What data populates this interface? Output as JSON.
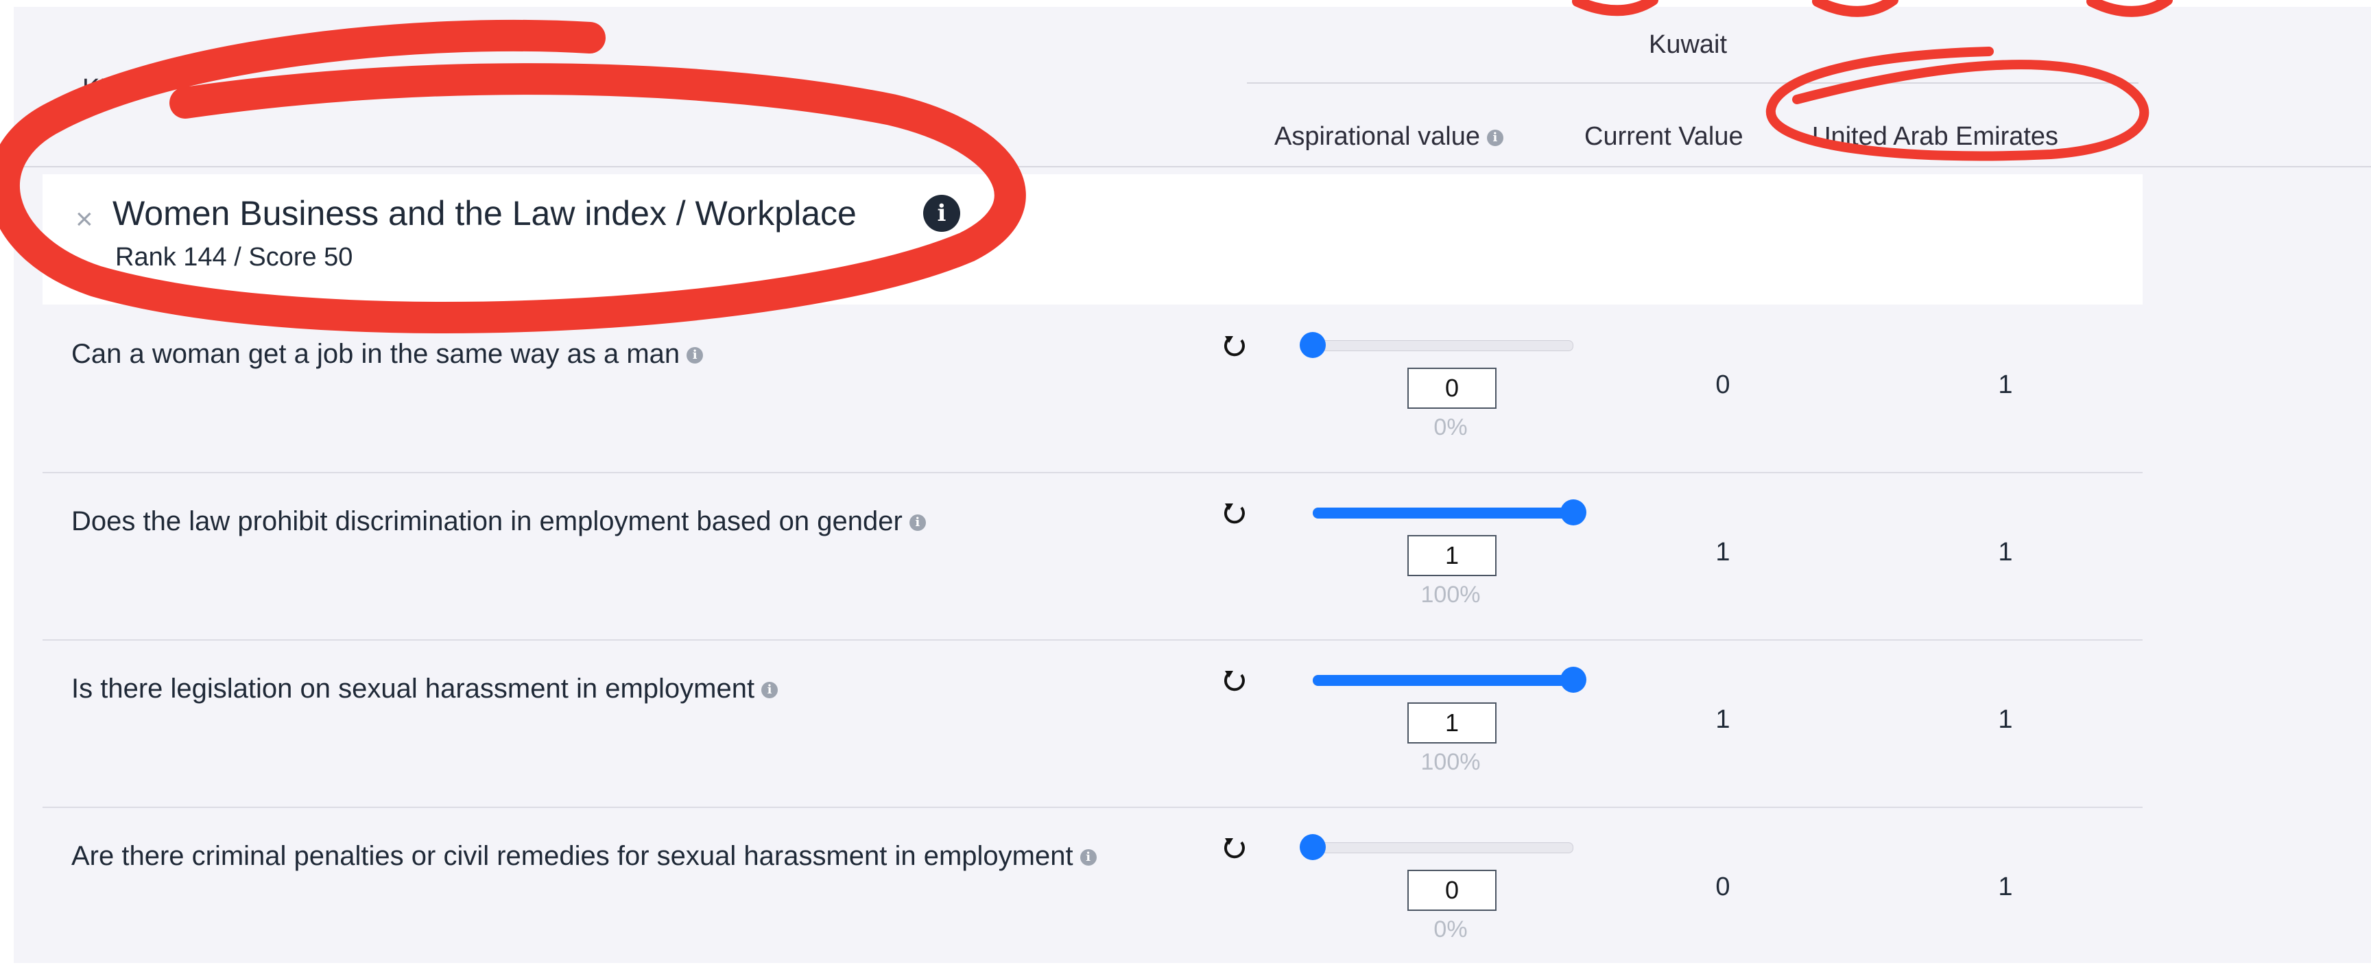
{
  "header": {
    "kpi_label": "KPI",
    "country": "Kuwait",
    "col_aspirational": "Aspirational value",
    "col_current": "Current Value",
    "col_compare": "United Arab Emirates"
  },
  "group": {
    "title": "Women Business and the Law index / Workplace",
    "subtitle": "Rank 144 / Score 50",
    "close_icon": "×",
    "info_icon": "i"
  },
  "rows": [
    {
      "question": "Can a woman get a job in the same way as a man",
      "value": "0",
      "percent": "0%",
      "current": "0",
      "compare": "1",
      "slider_fraction": 0
    },
    {
      "question": "Does the law prohibit discrimination in employment based on gender",
      "value": "1",
      "percent": "100%",
      "current": "1",
      "compare": "1",
      "slider_fraction": 1
    },
    {
      "question": "Is there legislation on sexual harassment in employment",
      "value": "1",
      "percent": "100%",
      "current": "1",
      "compare": "1",
      "slider_fraction": 1
    },
    {
      "question": "Are there criminal penalties or civil remedies for sexual harassment in employment",
      "value": "0",
      "percent": "0%",
      "current": "0",
      "compare": "1",
      "slider_fraction": 0
    }
  ],
  "icons": {
    "info": "info-icon",
    "reset": "reset-icon"
  },
  "colors": {
    "accent": "#1677ff",
    "annotation": "#ef3b2f",
    "background": "#f4f4f9"
  }
}
